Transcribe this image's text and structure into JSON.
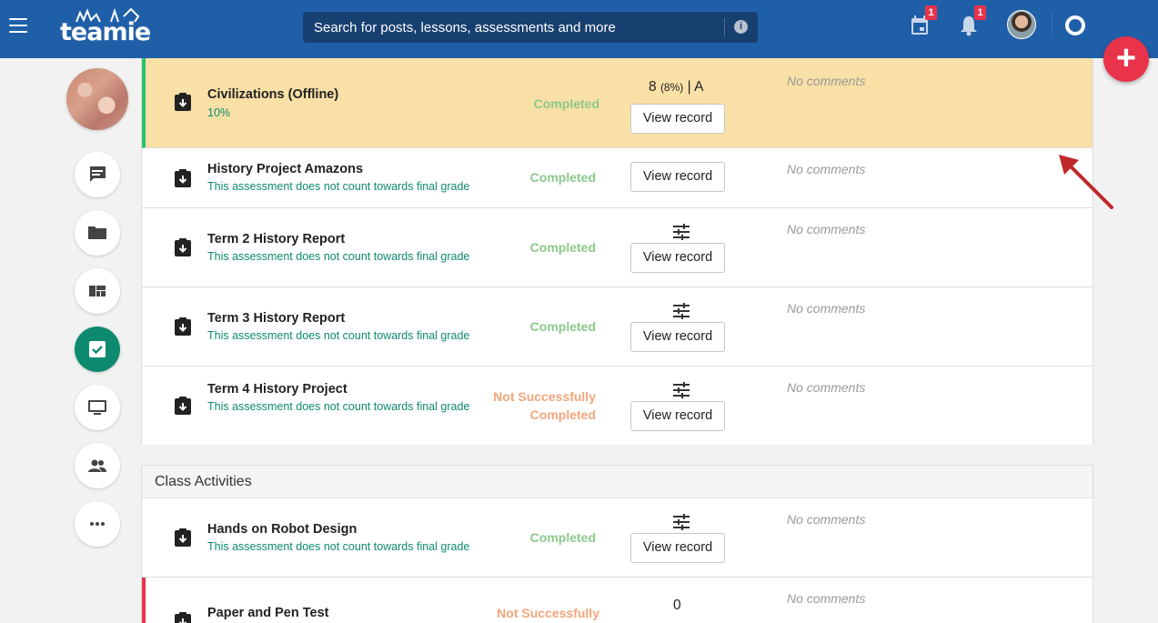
{
  "search": {
    "placeholder": "Search for posts, lessons, assessments and more"
  },
  "notifications": {
    "calendar_badge": "1",
    "bell_badge": "1"
  },
  "fab": {
    "label": "+"
  },
  "assessments": [
    {
      "title": "Civilizations (Offline)",
      "subtitle": "10%",
      "status": "Completed",
      "score": "8",
      "score_pct": "(8%)",
      "grade": "A",
      "button": "View record",
      "comment": "No comments"
    },
    {
      "title": "History Project Amazons",
      "subtitle": "This assessment does not count towards final grade",
      "status": "Completed",
      "button": "View record",
      "comment": "No comments"
    },
    {
      "title": "Term 2 History Report",
      "subtitle": "This assessment does not count towards final grade",
      "status": "Completed",
      "button": "View record",
      "comment": "No comments"
    },
    {
      "title": "Term 3 History Report",
      "subtitle": "This assessment does not count towards final grade",
      "status": "Completed",
      "button": "View record",
      "comment": "No comments"
    },
    {
      "title": "Term 4 History Project",
      "subtitle": "This assessment does not count towards final grade",
      "status_line1": "Not Successfully",
      "status_line2": "Completed",
      "button": "View record",
      "comment": "No comments"
    }
  ],
  "class_activities": {
    "title": "Class Activities",
    "items": [
      {
        "title": "Hands on Robot Design",
        "subtitle": "This assessment does not count towards final grade",
        "status": "Completed",
        "button": "View record",
        "comment": "No comments"
      },
      {
        "title": "Paper and Pen Test",
        "status": "Not Successfully",
        "score": "0",
        "comment": "No comments"
      }
    ]
  },
  "colors": {
    "topbar": "#1f5fa8",
    "accent_green": "#0e8a70",
    "highlight": "#f9e0a6",
    "fab": "#e8334a"
  }
}
